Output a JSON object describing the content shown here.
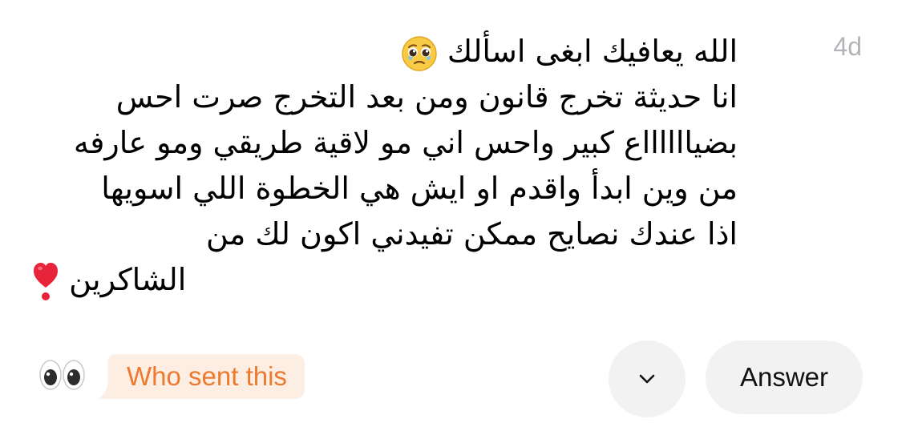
{
  "message": {
    "timestamp": "4d",
    "lines": [
      "الله يعافيك ابغى اسألك",
      "انا حديثة تخرج قانون ومن بعد التخرج صرت احس",
      "بضيااااااع كبير واحس اني مو لاقية طريقي ومو عارفه",
      "من وين ابدأ واقدم او ايش هي الخطوة اللي اسويها",
      "اذا عندك نصايح ممكن تفيدني اكون لك من",
      "الشاكرين"
    ],
    "emojis": {
      "pleading_face": "pleading-face-icon",
      "heart_exclamation": "heart-exclamation-icon"
    }
  },
  "actions": {
    "eyes_icon": "eyes-icon",
    "who_sent_label": "Who sent this",
    "more_icon": "chevron-down-icon",
    "answer_label": "Answer"
  },
  "colors": {
    "accent": "#ee7a2f",
    "pill_background": "#fdeee4",
    "button_background": "#f2f2f3",
    "timestamp": "#b3b3b8"
  }
}
